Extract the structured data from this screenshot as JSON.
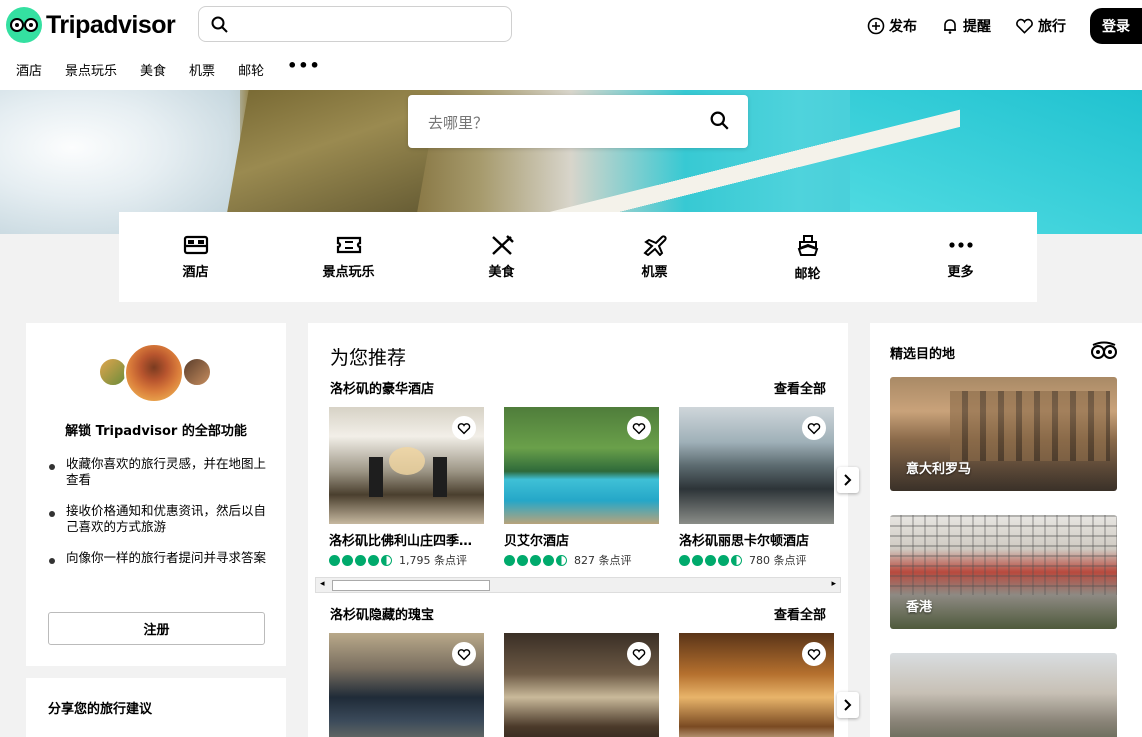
{
  "header": {
    "logo_text": "Tripadvisor",
    "actions": {
      "post": "发布",
      "alerts": "提醒",
      "trips": "旅行",
      "login": "登录"
    },
    "subnav": [
      "酒店",
      "景点玩乐",
      "美食",
      "机票",
      "邮轮"
    ],
    "more": "•••"
  },
  "hero": {
    "search_placeholder": "去哪里？"
  },
  "categories": [
    "酒店",
    "景点玩乐",
    "美食",
    "机票",
    "邮轮",
    "更多"
  ],
  "unlock_card": {
    "title": "解锁 Tripadvisor 的全部功能",
    "bullets": [
      "收藏你喜欢的旅行灵感，并在地图上查看",
      "接收价格通知和优惠资讯，然后以自己喜欢的方式旅游",
      "向像你一样的旅行者提问并寻求答案"
    ],
    "signup": "注册"
  },
  "share_card": {
    "title": "分享您的旅行建议"
  },
  "recommendations": {
    "title": "为您推荐",
    "sections": [
      {
        "heading": "洛杉矶的豪华酒店",
        "see_all": "查看全部",
        "items": [
          {
            "name": "洛杉矶比佛利山庄四季…",
            "reviews": "1,795 条点评"
          },
          {
            "name": "贝艾尔酒店",
            "reviews": "827 条点评"
          },
          {
            "name": "洛杉矶丽思卡尔顿酒店",
            "reviews": "780 条点评"
          }
        ]
      },
      {
        "heading": "洛杉矶隐藏的瑰宝",
        "see_all": "查看全部"
      }
    ]
  },
  "destinations": {
    "title": "精选目的地",
    "items": [
      "意大利罗马",
      "香港"
    ]
  },
  "colors": {
    "brand_green": "#34e0a1",
    "rating_green": "#00aa6c"
  }
}
